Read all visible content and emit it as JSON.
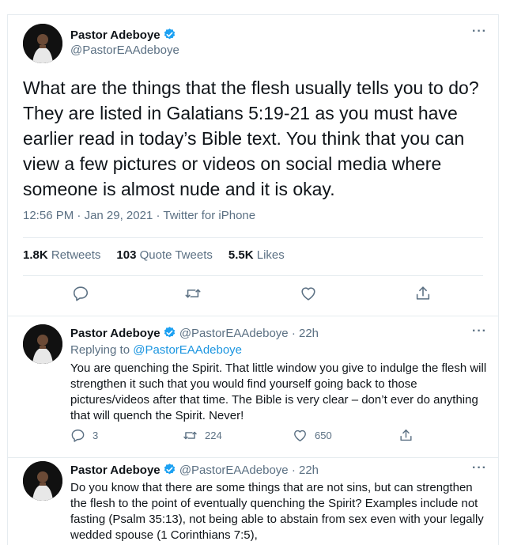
{
  "main_tweet": {
    "author_name": "Pastor Adeboye",
    "author_handle": "@PastorEAAdeboye",
    "text": "What are the things that the flesh usually tells you to do? They are listed in Galatians 5:19-21 as you must have earlier read in today’s Bible text. You think that you can view a few pictures or videos on social media where someone is almost nude and it is okay.",
    "time": "12:56 PM",
    "date": "Jan 29, 2021",
    "source": "Twitter for iPhone",
    "retweets_count": "1.8K",
    "retweets_label": "Retweets",
    "quotes_count": "103",
    "quotes_label": "Quote Tweets",
    "likes_count": "5.5K",
    "likes_label": "Likes"
  },
  "replies": [
    {
      "author_name": "Pastor Adeboye",
      "author_handle": "@PastorEAAdeboye",
      "time_ago": "22h",
      "replying_label": "Replying to",
      "replying_to": "@PastorEAAdeboye",
      "text": "You are quenching the Spirit. That little window you give to indulge the flesh will strengthen it such that you would find yourself going back to those pictures/videos after that time. The Bible is very clear – don’t ever do anything that will quench the Spirit. Never!",
      "reply_count": "3",
      "retweet_count": "224",
      "like_count": "650"
    },
    {
      "author_name": "Pastor Adeboye",
      "author_handle": "@PastorEAAdeboye",
      "time_ago": "22h",
      "text": "Do you know that there are some things that are not sins, but can strengthen the flesh to the point of eventually quenching the Spirit? Examples include not fasting (Psalm 35:13), not being able to abstain from sex even with your legally wedded spouse (1 Corinthians 7:5),"
    }
  ],
  "icons": {
    "verified": "verified-badge-icon",
    "more": "more-options-icon",
    "reply": "reply-icon",
    "retweet": "retweet-icon",
    "like": "heart-icon",
    "share": "share-icon"
  },
  "colors": {
    "verified": "#1da1f2",
    "link": "#1b95e0",
    "secondary_text": "#5b7083",
    "border": "#e6ecf0"
  }
}
